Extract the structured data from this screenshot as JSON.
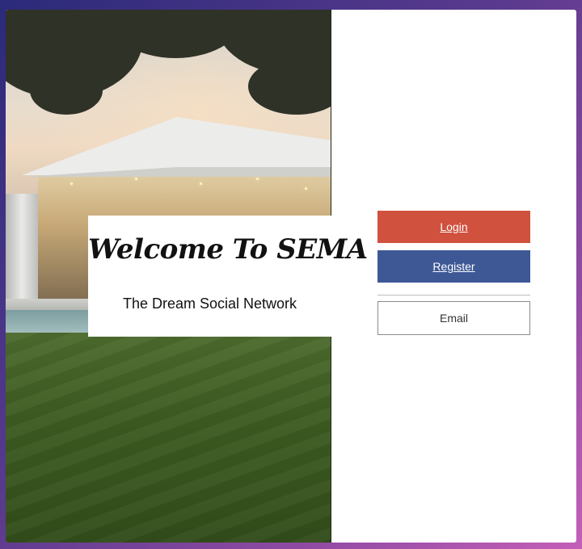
{
  "hero": {
    "title": "Welcome To SEMA",
    "subtitle": "The Dream Social Network"
  },
  "auth": {
    "login_label": "Login",
    "register_label": "Register",
    "email_label": "Email"
  },
  "colors": {
    "login": "#d0513e",
    "register": "#3e5896",
    "background_gradient_start": "#2b2a7a",
    "background_gradient_end": "#c45fb8"
  }
}
